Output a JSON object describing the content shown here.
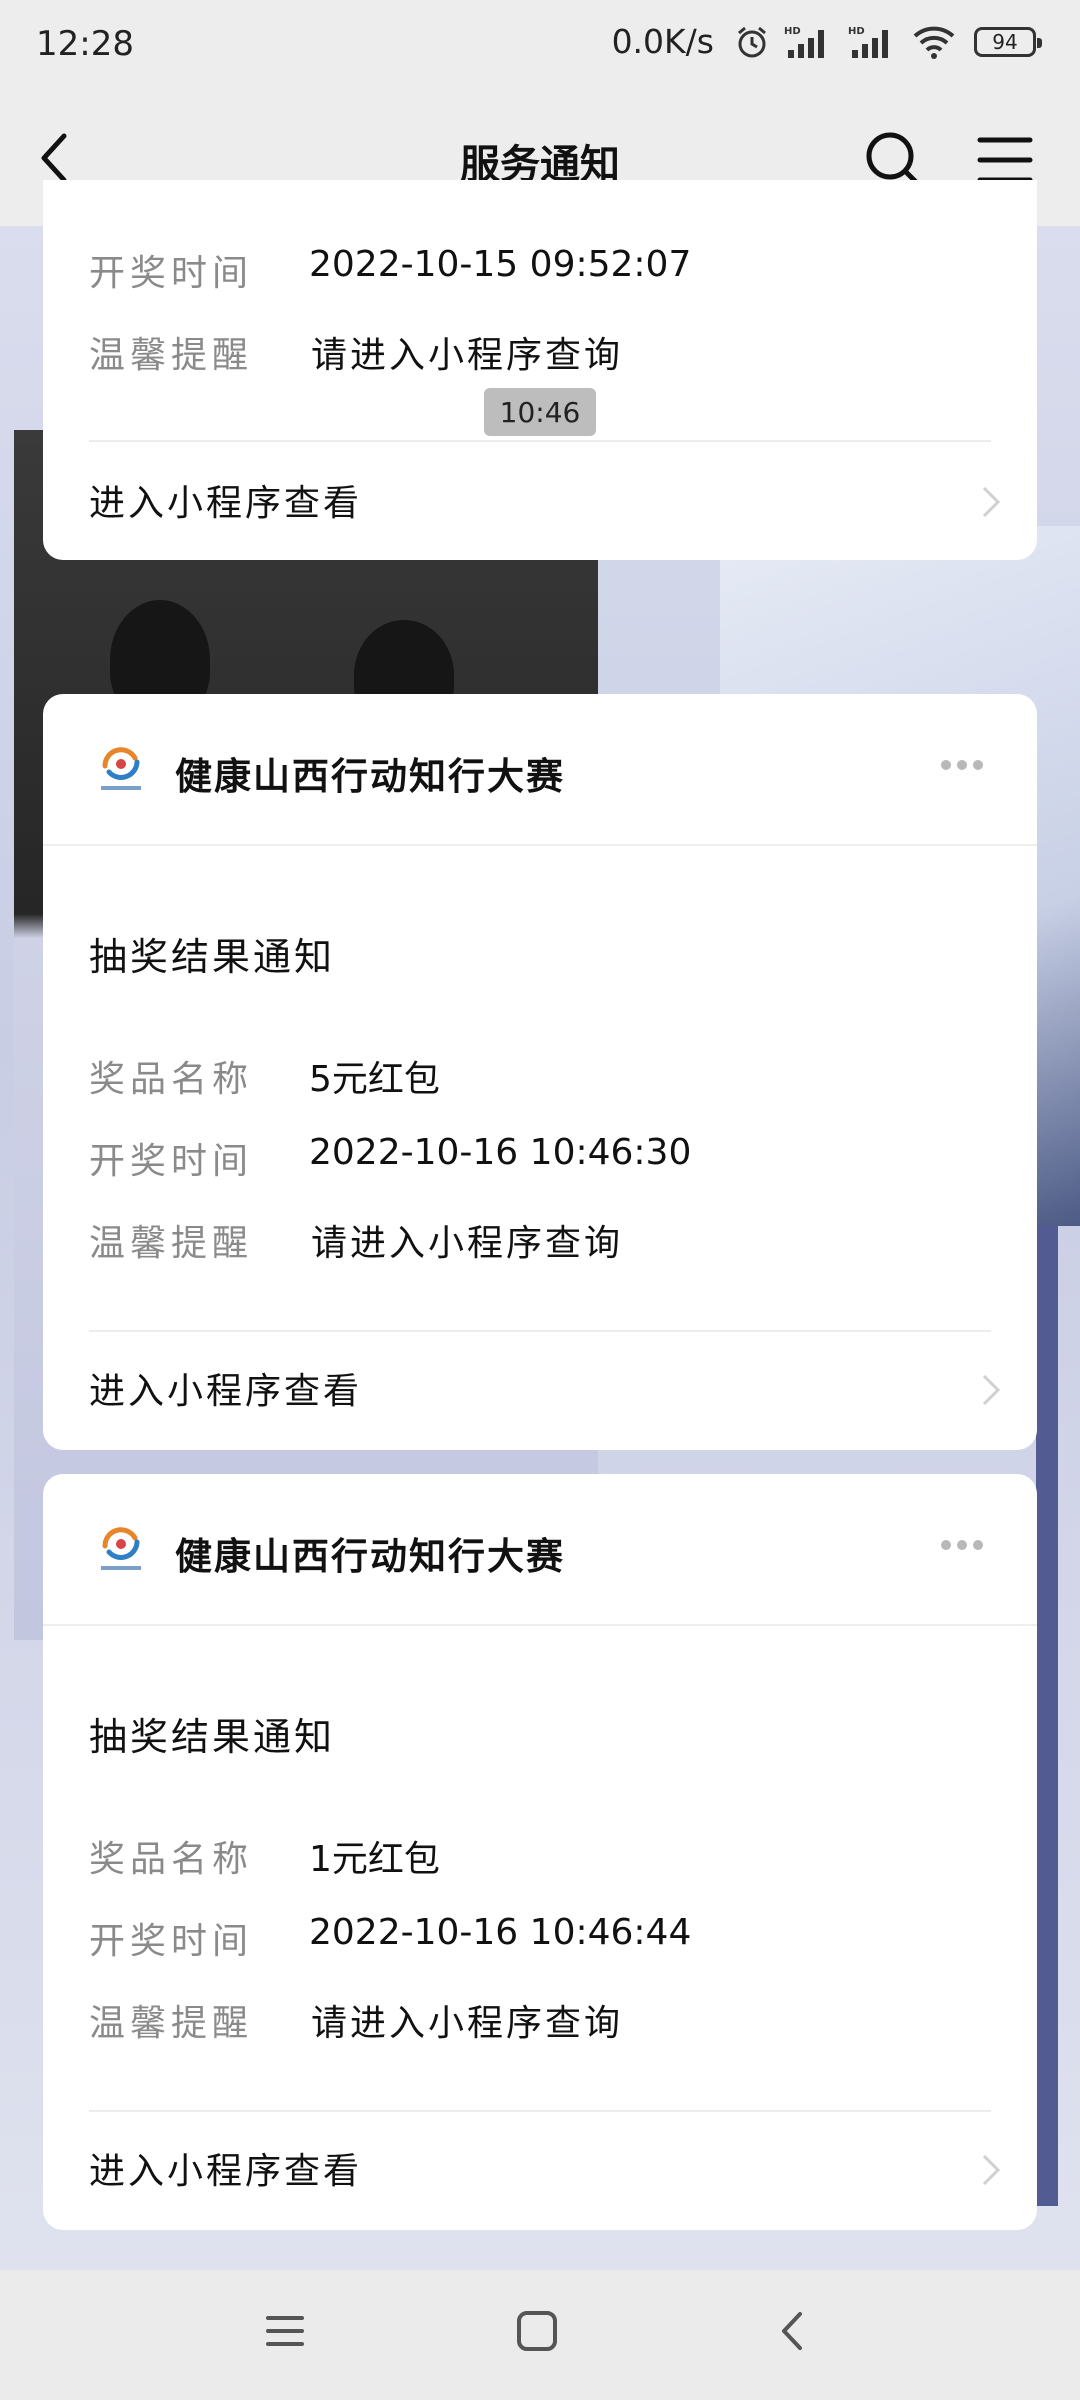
{
  "status_bar": {
    "time": "12:28",
    "network_speed": "0.0K/s",
    "battery": "94",
    "icons": [
      "alarm-icon",
      "hd-signal-icon",
      "hd-signal-icon",
      "wifi-icon",
      "battery-icon"
    ]
  },
  "nav": {
    "title": "服务通知",
    "icons": [
      "back-icon",
      "search-icon",
      "menu-icon"
    ]
  },
  "timestamp": "10:46",
  "card1": {
    "rows": [
      {
        "label": "开奖时间",
        "value": "2022-10-15 09:52:07"
      },
      {
        "label": "温馨提醒",
        "value": "请进入小程序查询"
      }
    ],
    "link": "进入小程序查看"
  },
  "card2": {
    "source": "健康山西行动知行大赛",
    "title": "抽奖结果通知",
    "rows": [
      {
        "label": "奖品名称",
        "value": "5元红包"
      },
      {
        "label": "开奖时间",
        "value": "2022-10-16 10:46:30"
      },
      {
        "label": "温馨提醒",
        "value": "请进入小程序查询"
      }
    ],
    "link": "进入小程序查看"
  },
  "card3": {
    "source": "健康山西行动知行大赛",
    "title": "抽奖结果通知",
    "rows": [
      {
        "label": "奖品名称",
        "value": "1元红包"
      },
      {
        "label": "开奖时间",
        "value": "2022-10-16 10:46:44"
      },
      {
        "label": "温馨提醒",
        "value": "请进入小程序查询"
      }
    ],
    "link": "进入小程序查看"
  },
  "system_nav": {
    "icons": [
      "recents-icon",
      "home-icon",
      "back-icon"
    ]
  }
}
